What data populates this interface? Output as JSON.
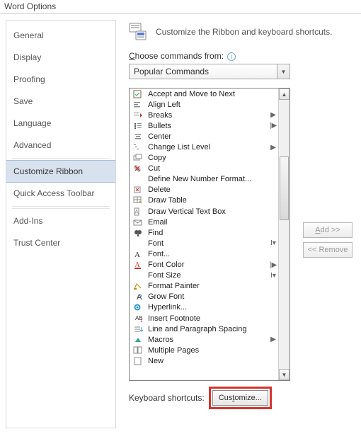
{
  "window": {
    "title": "Word Options"
  },
  "sidebar": {
    "items": [
      {
        "label": "General"
      },
      {
        "label": "Display"
      },
      {
        "label": "Proofing"
      },
      {
        "label": "Save"
      },
      {
        "label": "Language"
      },
      {
        "label": "Advanced"
      },
      {
        "label": "Customize Ribbon",
        "selected": true
      },
      {
        "label": "Quick Access Toolbar"
      },
      {
        "label": "Add-Ins"
      },
      {
        "label": "Trust Center"
      }
    ]
  },
  "header": {
    "text": "Customize the Ribbon and keyboard shortcuts."
  },
  "choose_label_pre": "C",
  "choose_label_rest": "hoose commands from:",
  "combo_value": "Popular Commands",
  "commands": [
    {
      "label": "Accept and Move to Next",
      "sub": ""
    },
    {
      "label": "Align Left",
      "sub": ""
    },
    {
      "label": "Breaks",
      "sub": "▶"
    },
    {
      "label": "Bullets",
      "sub": "|▶"
    },
    {
      "label": "Center",
      "sub": ""
    },
    {
      "label": "Change List Level",
      "sub": "▶"
    },
    {
      "label": "Copy",
      "sub": ""
    },
    {
      "label": "Cut",
      "sub": ""
    },
    {
      "label": "Define New Number Format...",
      "sub": ""
    },
    {
      "label": "Delete",
      "sub": ""
    },
    {
      "label": "Draw Table",
      "sub": ""
    },
    {
      "label": "Draw Vertical Text Box",
      "sub": ""
    },
    {
      "label": "Email",
      "sub": ""
    },
    {
      "label": "Find",
      "sub": ""
    },
    {
      "label": "Font",
      "sub": "I▾"
    },
    {
      "label": "Font...",
      "sub": ""
    },
    {
      "label": "Font Color",
      "sub": "|▶"
    },
    {
      "label": "Font Size",
      "sub": "I▾"
    },
    {
      "label": "Format Painter",
      "sub": ""
    },
    {
      "label": "Grow Font",
      "sub": ""
    },
    {
      "label": "Hyperlink...",
      "sub": ""
    },
    {
      "label": "Insert Footnote",
      "sub": ""
    },
    {
      "label": "Line and Paragraph Spacing",
      "sub": ""
    },
    {
      "label": "Macros",
      "sub": "▶"
    },
    {
      "label": "Multiple Pages",
      "sub": ""
    },
    {
      "label": "New",
      "sub": ""
    }
  ],
  "side_buttons": {
    "add": "Add >>",
    "remove": "<< Remove"
  },
  "footer": {
    "label": "Keyboard shortcuts:",
    "btn_pre": "Cus",
    "btn_u": "t",
    "btn_post": "omize..."
  }
}
